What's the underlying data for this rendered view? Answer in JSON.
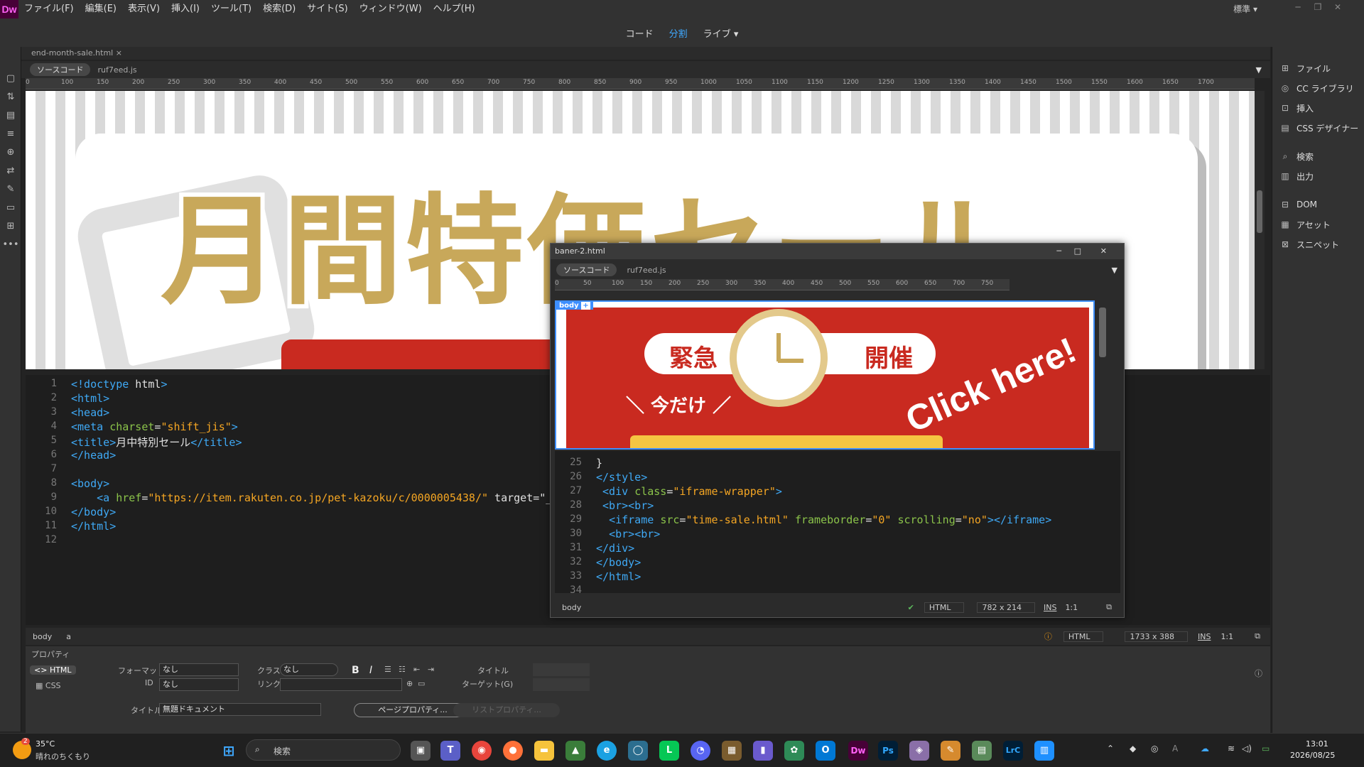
{
  "app": {
    "logo": "Dw"
  },
  "menu": [
    "ファイル(F)",
    "編集(E)",
    "表示(V)",
    "挿入(I)",
    "ツール(T)",
    "検索(D)",
    "サイト(S)",
    "ウィンドウ(W)",
    "ヘルプ(H)"
  ],
  "workspace": "標準",
  "view_modes": {
    "code": "コード",
    "split": "分割",
    "live": "ライブ",
    "active": "分割"
  },
  "doc_tab": "end-month-sale.html",
  "related": {
    "source": "ソースコード",
    "file": "ruf7eed.js"
  },
  "ruler_main": [
    "0",
    "100",
    "150",
    "200",
    "250",
    "300",
    "350",
    "400",
    "450",
    "500",
    "550",
    "600",
    "650",
    "700",
    "750",
    "800",
    "850",
    "900",
    "950",
    "1000",
    "1050",
    "1100",
    "1150",
    "1200",
    "1250",
    "1300",
    "1350",
    "1400",
    "1450",
    "1500",
    "1550",
    "1600",
    "1650",
    "1700"
  ],
  "banner": {
    "headline": "月間特価セール"
  },
  "main_code": {
    "lines": [
      {
        "n": "1",
        "t": "<!doctype html>"
      },
      {
        "n": "2",
        "t": "<html>"
      },
      {
        "n": "3",
        "t": "<head>"
      },
      {
        "n": "4",
        "t": "<meta charset=\"shift_jis\">"
      },
      {
        "n": "5",
        "t": "<title>月中特別セール</title>"
      },
      {
        "n": "6",
        "t": "</head>"
      },
      {
        "n": "7",
        "t": ""
      },
      {
        "n": "8",
        "t": "<body>"
      },
      {
        "n": "9",
        "t": "    <a href=\"https://item.rakuten.co.jp/pet-kazoku/c/0000005438/\" target=\"_"
      },
      {
        "n": "10",
        "t": "</body>"
      },
      {
        "n": "11",
        "t": "</html>"
      },
      {
        "n": "12",
        "t": ""
      }
    ]
  },
  "status": {
    "crumbs": [
      "body",
      "a"
    ],
    "lang": "HTML",
    "size": "1733 x 388",
    "mode": "INS",
    "pos": "1:1"
  },
  "properties": {
    "title": "プロパティ",
    "html_btn": "HTML",
    "css_btn": "CSS",
    "format_label": "フォーマット",
    "format_value": "なし",
    "id_label": "ID",
    "id_value": "なし",
    "class_label": "クラス",
    "class_value": "なし",
    "link_label": "リンク",
    "title_label": "タイトル",
    "target_label": "ターゲット(G)",
    "doc_title_label": "タイトル",
    "doc_title_value": "無題ドキュメント",
    "page_props": "ページプロパティ...",
    "list_props": "リストプロパティ..."
  },
  "right_panel": [
    "ファイル",
    "CC ライブラリ",
    "挿入",
    "CSS デザイナー",
    "検索",
    "出力",
    "DOM",
    "アセット",
    "スニペット"
  ],
  "float_window": {
    "title": "baner-2.html",
    "source": "ソースコード",
    "file": "ruf7eed.js",
    "ruler": [
      "0",
      "50",
      "100",
      "150",
      "200",
      "250",
      "300",
      "350",
      "400",
      "450",
      "500",
      "550",
      "600",
      "650",
      "700",
      "750"
    ],
    "body_tag": "body",
    "banner": {
      "urgent": "緊急",
      "held": "開催",
      "only_now": "＼ 今だけ ／",
      "click": "Click here!"
    },
    "code_lines": [
      {
        "n": "25",
        "t": "}"
      },
      {
        "n": "26",
        "t": "</style>"
      },
      {
        "n": "27",
        "t": " <div class=\"iframe-wrapper\">"
      },
      {
        "n": "28",
        "t": " <br><br>"
      },
      {
        "n": "29",
        "t": "  <iframe src=\"time-sale.html\" frameborder=\"0\" scrolling=\"no\"></iframe>"
      },
      {
        "n": "30",
        "t": "  <br><br>"
      },
      {
        "n": "31",
        "t": "</div>"
      },
      {
        "n": "32",
        "t": "</body>"
      },
      {
        "n": "33",
        "t": "</html>"
      },
      {
        "n": "34",
        "t": ""
      }
    ],
    "status": {
      "crumb": "body",
      "lang": "HTML",
      "size": "782 x 214",
      "mode": "INS",
      "pos": "1:1"
    }
  },
  "taskbar": {
    "weather_temp": "35°C",
    "weather_desc": "晴れのちくもり",
    "weather_badge": "2",
    "search": "検索",
    "time": "13:01",
    "date": "2026/08/25"
  }
}
